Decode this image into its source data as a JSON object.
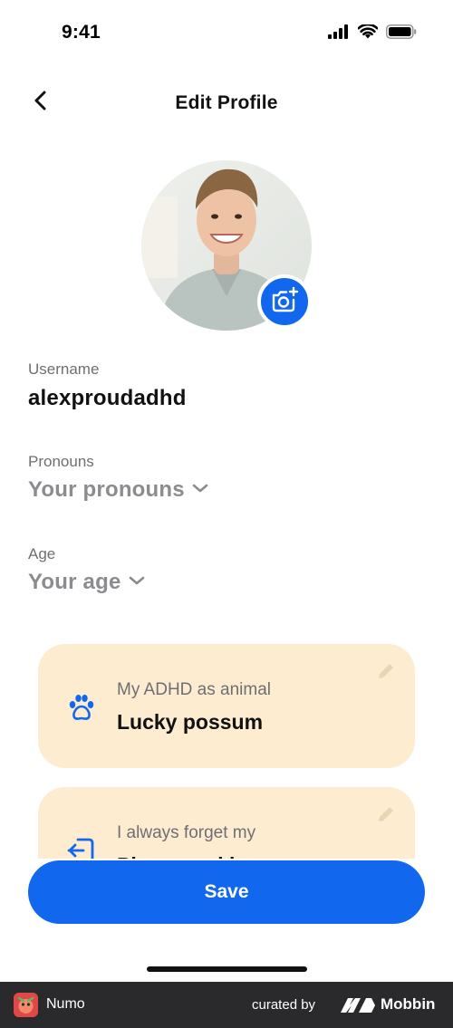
{
  "status_bar": {
    "time": "9:41"
  },
  "header": {
    "title": "Edit Profile"
  },
  "profile": {
    "username_label": "Username",
    "username_value": "alexproudadhd",
    "pronouns_label": "Pronouns",
    "pronouns_placeholder": "Your pronouns",
    "age_label": "Age",
    "age_placeholder": "Your age"
  },
  "cards": [
    {
      "label": "My ADHD as animal",
      "value": "Lucky possum",
      "icon": "paw-icon"
    },
    {
      "label": "I always forget my",
      "value": "Phone and keys",
      "icon": "door-exit-icon"
    }
  ],
  "actions": {
    "save_label": "Save"
  },
  "footer": {
    "app_name": "Numo",
    "curated_by": "curated by",
    "brand": "Mobbin"
  },
  "colors": {
    "accent": "#1168ef",
    "card_bg": "#fdecd0",
    "muted_text": "#8c8c90",
    "footer_bg": "#2a2a2c"
  }
}
